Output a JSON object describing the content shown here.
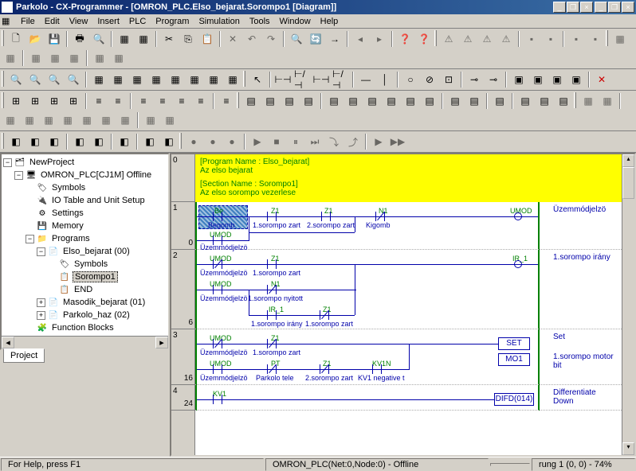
{
  "title": "Parkolo - CX-Programmer - [OMRON_PLC.Elso_bejarat.Sorompo1 [Diagram]]",
  "menu": [
    "File",
    "Edit",
    "View",
    "Insert",
    "PLC",
    "Program",
    "Simulation",
    "Tools",
    "Window",
    "Help"
  ],
  "tree": {
    "root": "NewProject",
    "plc": "OMRON_PLC[CJ1M] Offline",
    "symbols": "Symbols",
    "io": "IO Table and Unit Setup",
    "settings": "Settings",
    "memory": "Memory",
    "programs": "Programs",
    "elso": "Elso_bejarat (00)",
    "elso_symbols": "Symbols",
    "sorompo1": "Sorompo1",
    "end": "END",
    "masodik": "Masodik_bejarat (01)",
    "parkolo": "Parkolo_haz (02)",
    "fb": "Function Blocks"
  },
  "tree_tab": "Project",
  "header": {
    "prog_line": "[Program Name : Elso_bejarat]",
    "prog_sub": "Az elso bejarat",
    "sect_line": "[Section Name : Sorompo1]",
    "sect_sub": "Az elso sorompo vezerlese"
  },
  "rungs": [
    {
      "idx": "0",
      "addr": "0"
    },
    {
      "idx": "1",
      "addr": "0"
    },
    {
      "idx": "2",
      "addr": "6"
    },
    {
      "idx": "3",
      "addr": "16"
    },
    {
      "idx": "4",
      "addr": "24"
    }
  ],
  "ladder_labels": {
    "be": "Be",
    "begomb": "Begomb",
    "z1": "Z1",
    "n1": "N1",
    "sorompo1zart": "1.sorompo zart",
    "sorompo2zart": "2.sorompo zart",
    "kigomb": "Kigomb",
    "umod": "UMOD",
    "uzemmodjelzo": "Üzemmódjelzö",
    "ir1": "IR_1",
    "sorompoirany": "1.sorompo irány",
    "soromponyitott": "1.sorompo nyitott",
    "pt": "PT",
    "parkolotele": "Parkolo tele",
    "kv1n": "KV1N",
    "kv1negative": "KV1 negative t",
    "kv1": "KV1",
    "set": "SET",
    "mo1": "MO1",
    "set_desc": "Set",
    "sorompomotor": "1.sorompo motor bit",
    "difd": "DIFD(014)",
    "diffdown": "Differentiate Down"
  },
  "status": {
    "help": "For Help, press F1",
    "conn": "OMRON_PLC(Net:0,Node:0) - Offline",
    "rung": "rung 1 (0, 0) - 74%"
  }
}
